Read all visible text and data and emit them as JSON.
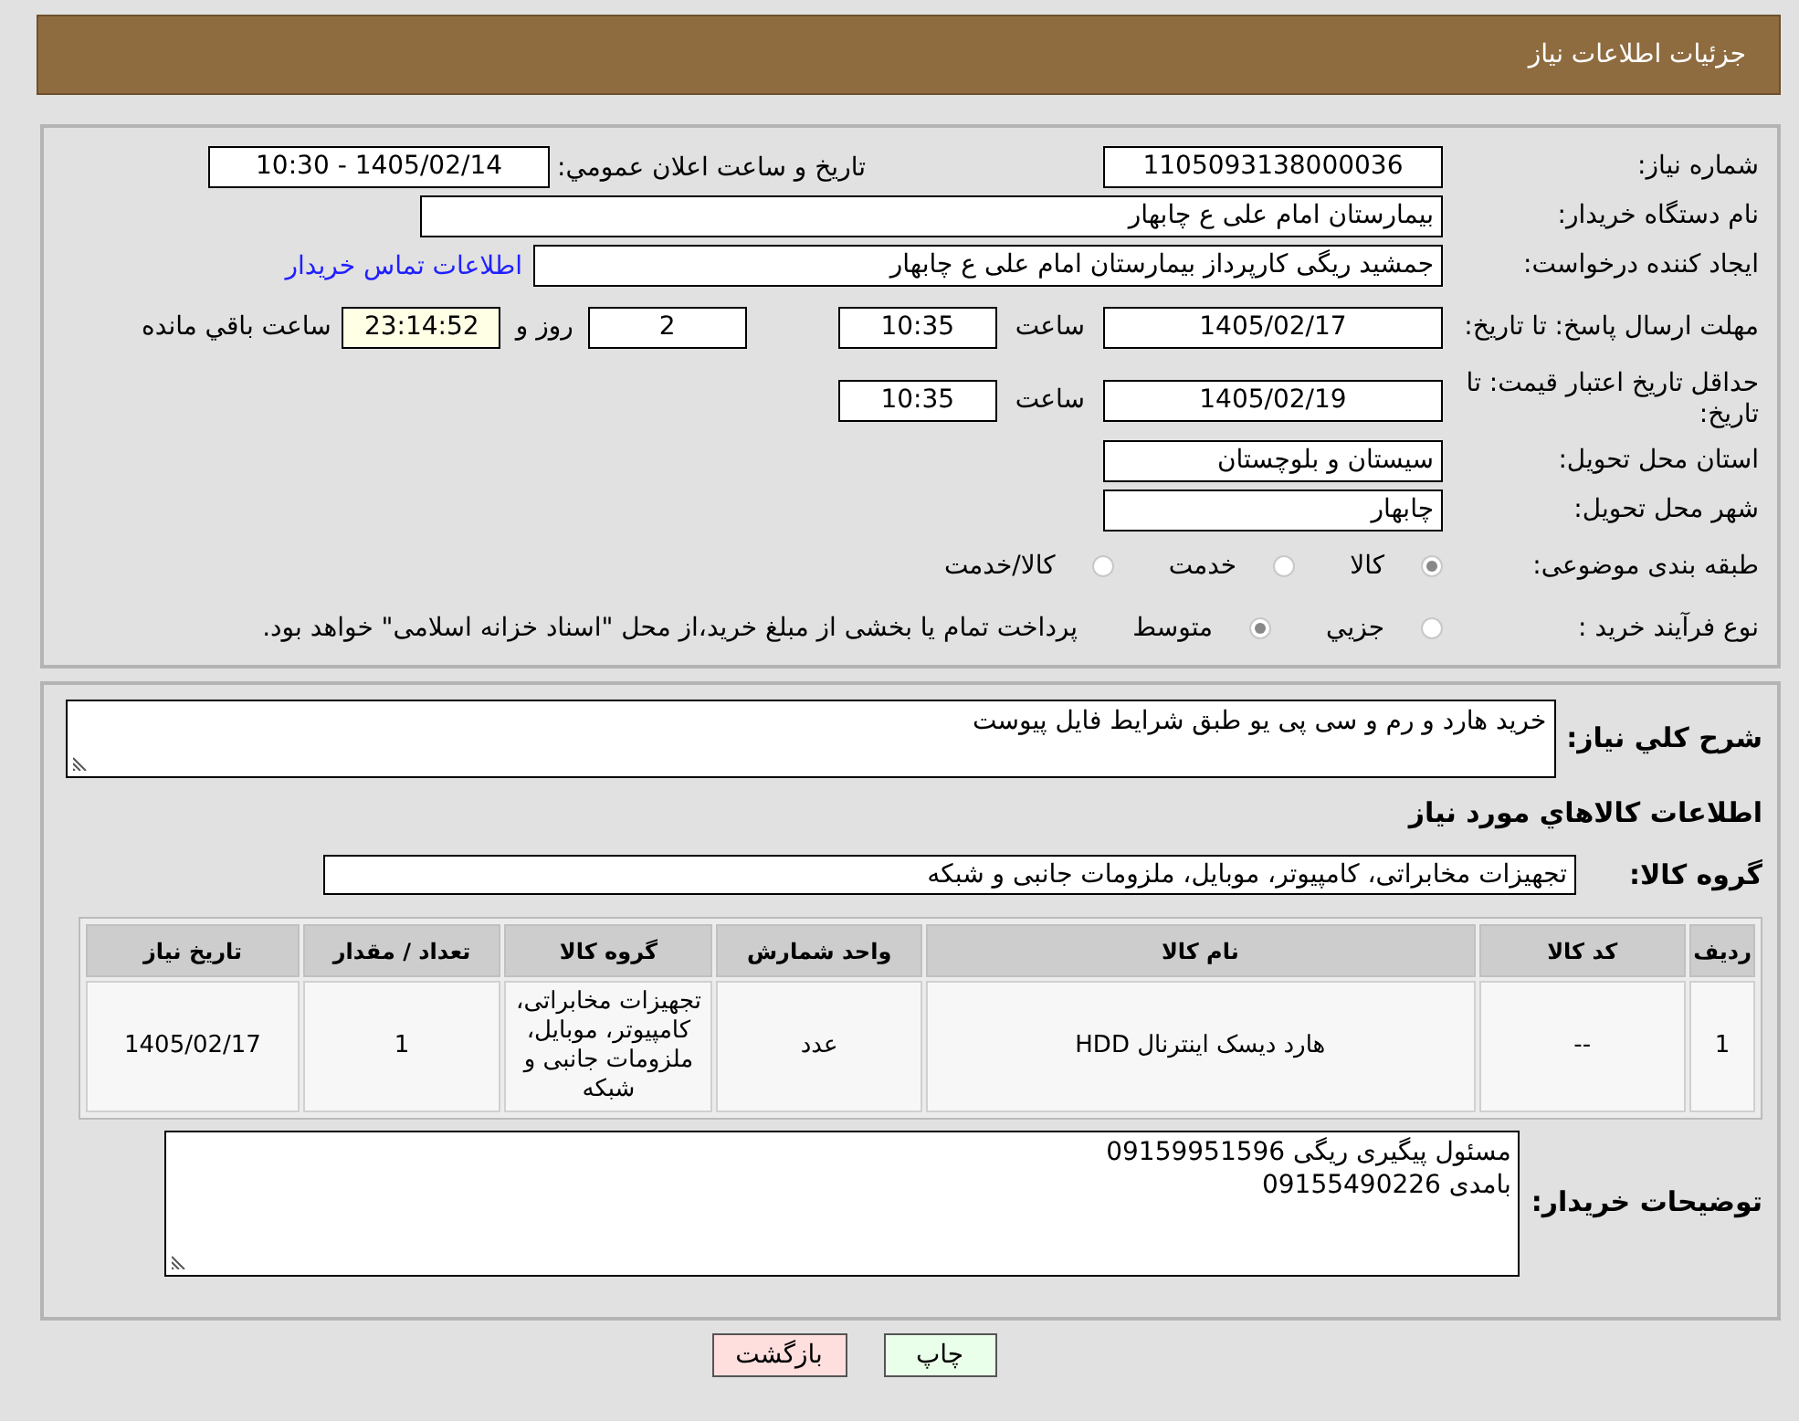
{
  "header": {
    "title": "جزئیات اطلاعات نیاز"
  },
  "details": {
    "need_number": {
      "label": "شماره نیاز:",
      "value": "1105093138000036"
    },
    "announce": {
      "label": "تاريخ و ساعت اعلان عمومي:",
      "value": "1405/02/14 - 10:30"
    },
    "buyer": {
      "label": "نام دستگاه خریدار:",
      "value": "بیمارستان امام علی  ع  چابهار"
    },
    "requester": {
      "label": "ایجاد کننده درخواست:",
      "value": "جمشید ریگی کارپرداز بیمارستان امام علی  ع  چابهار",
      "contact_link": "اطلاعات تماس خریدار"
    },
    "reply_deadline": {
      "label": "مهلت ارسال پاسخ: تا تاریخ:",
      "date": "1405/02/17",
      "time_label": "ساعت",
      "time": "10:35",
      "days": "2",
      "days_label": "روز و",
      "remaining": "23:14:52",
      "remaining_label": "ساعت باقي مانده"
    },
    "price_validity": {
      "label": "حداقل تاریخ اعتبار قیمت: تا تاریخ:",
      "date": "1405/02/19",
      "time_label": "ساعت",
      "time": "10:35"
    },
    "province": {
      "label": "استان محل تحویل:",
      "value": "سیستان و بلوچستان"
    },
    "city": {
      "label": "شهر محل تحویل:",
      "value": "چابهار"
    },
    "category": {
      "label": "طبقه بندی موضوعی:",
      "options": [
        {
          "label": "کالا",
          "selected": true
        },
        {
          "label": "خدمت",
          "selected": false
        },
        {
          "label": "کالا/خدمت",
          "selected": false
        }
      ]
    },
    "purchase_type": {
      "label": "نوع فرآیند خرید :",
      "options": [
        {
          "label": "جزيي",
          "selected": false
        },
        {
          "label": "متوسط",
          "selected": true
        }
      ],
      "note": "پرداخت تمام یا بخشی از مبلغ خرید،از محل \"اسناد خزانه اسلامی\" خواهد بود."
    }
  },
  "description": {
    "label": "شرح کلي نياز:",
    "value": "خرید هارد و رم و سی پی یو طبق شرایط فایل پیوست"
  },
  "goods_heading": "اطلاعات کالاهاي مورد نياز",
  "goods_group": {
    "label": "گروه کالا:",
    "value": "تجهیزات مخابراتی، کامپیوتر، موبایل، ملزومات جانبی و شبکه"
  },
  "table": {
    "columns": [
      "ردیف",
      "کد کالا",
      "نام کالا",
      "واحد شمارش",
      "گروه کالا",
      "تعداد / مقدار",
      "تاریخ نیاز"
    ],
    "rows": [
      [
        "1",
        "--",
        "هارد دیسک اینترنال HDD",
        "عدد",
        "تجهیزات مخابراتی، کامپیوتر، موبایل، ملزومات جانبی و شبکه",
        "1",
        "1405/02/17"
      ]
    ]
  },
  "buyer_notes": {
    "label": "توضیحات خریدار:",
    "lines": [
      "مسئول پیگیری ریگی 09159951596",
      "بامدی 09155490226"
    ]
  },
  "buttons": [
    {
      "label": "چاپ",
      "kind": "print"
    },
    {
      "label": "بازگشت",
      "kind": "back"
    }
  ]
}
